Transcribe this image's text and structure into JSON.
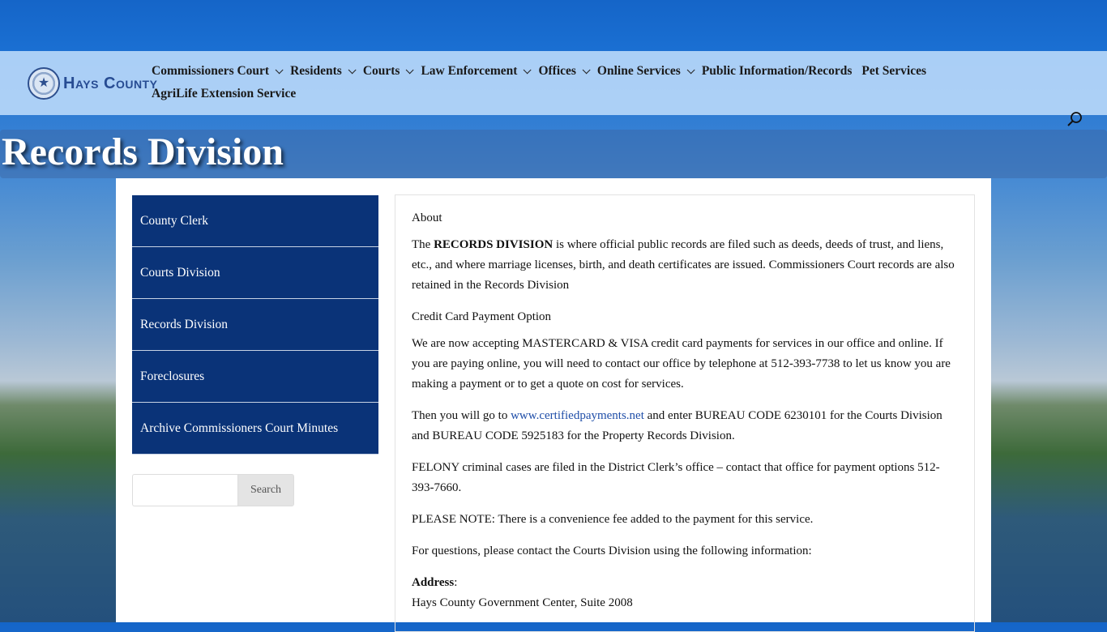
{
  "header": {
    "logo_text": "Hays County",
    "nav": [
      {
        "label": "Commissioners Court",
        "dropdown": true
      },
      {
        "label": "Residents",
        "dropdown": true
      },
      {
        "label": "Courts",
        "dropdown": true
      },
      {
        "label": "Law Enforcement",
        "dropdown": true
      },
      {
        "label": "Offices",
        "dropdown": true
      },
      {
        "label": "Online Services",
        "dropdown": true
      },
      {
        "label": "Public Information/Records",
        "dropdown": false
      },
      {
        "label": "Pet Services",
        "dropdown": false
      }
    ],
    "nav_row2": "AgriLife Extension Service"
  },
  "page_title": "Records Division",
  "sidebar": {
    "items": [
      {
        "label": "County Clerk"
      },
      {
        "label": "Courts Division"
      },
      {
        "label": "Records Division"
      },
      {
        "label": "Foreclosures"
      },
      {
        "label": "Archive Commissioners Court Minutes"
      }
    ],
    "search_button": "Search",
    "search_value": ""
  },
  "main": {
    "about_heading": "About",
    "intro_pre": "The ",
    "intro_bold": "RECORDS DIVISION",
    "intro_post": " is where official public records are filed such as deeds, deeds of trust, and liens, etc., and where marriage licenses, birth, and death certificates are issued. Commissioners Court records are also retained in the Records Division",
    "credit_heading": "Credit Card Payment Option",
    "credit_text": "We are now accepting MASTERCARD & VISA credit card payments for services in our office and online. If you are paying online, you will need to contact our office by telephone at 512-393-7738 to let us know you are making a payment or to get a quote on cost for services.",
    "bureau_pre": "Then you will go to ",
    "bureau_link": "www.certifiedpayments.net",
    "bureau_post": " and enter BUREAU CODE 6230101 for the Courts Division and BUREAU CODE 5925183 for the Property Records Division.",
    "felony_text": "FELONY criminal cases are filed in the District Clerk’s office – contact that office for payment options 512-393-7660.",
    "note_text": "PLEASE NOTE: There is a convenience fee added to the payment for this service.",
    "questions_text": "For questions, please contact the Courts Division using the following information:",
    "address_label": "Address",
    "address_colon": ":",
    "address_line1": "Hays County Government Center, Suite 2008"
  }
}
